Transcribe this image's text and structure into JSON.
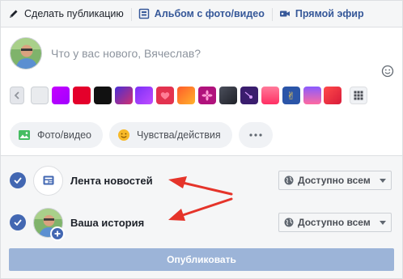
{
  "tabs": [
    {
      "label": "Сделать публикацию",
      "icon": "pencil-icon"
    },
    {
      "label": "Альбом с фото/видео",
      "icon": "album-icon"
    },
    {
      "label": "Прямой эфир",
      "icon": "video-camera-icon"
    }
  ],
  "composer": {
    "placeholder": "Что у вас нового, Вячеслав?",
    "background_colors": [
      "#e9ebee",
      "#c600ff",
      "#e4002b",
      "#111111",
      "#7b2ff7",
      "#9b3bf0",
      "#e3324f",
      "#f77c24",
      "#e04a9b",
      "#2d2f3a",
      "#3a1d6e",
      "#ff4f7b",
      "#ff8a00",
      "#6b5cff",
      "#e9305f",
      "#e9e9e9"
    ]
  },
  "actions": [
    {
      "label": "Фото/видео",
      "icon": "photo-icon"
    },
    {
      "label": "Чувства/действия",
      "icon": "smiley-icon"
    },
    {
      "label": "",
      "icon": "more-icon"
    }
  ],
  "destinations": [
    {
      "label": "Лента новостей",
      "audience": "Доступно всем",
      "checked": true
    },
    {
      "label": "Ваша история",
      "audience": "Доступно всем",
      "checked": true
    }
  ],
  "publish_label": "Опубликовать",
  "colors": {
    "brand": "#4267b2",
    "link": "#365899",
    "publish_disabled": "#9cb4d8",
    "annotation_arrow": "#e5342a"
  }
}
